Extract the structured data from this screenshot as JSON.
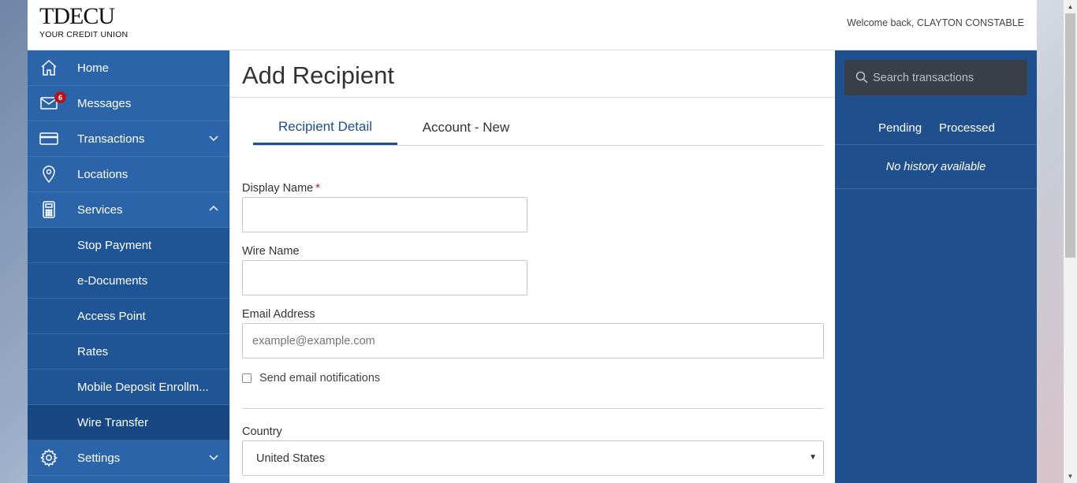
{
  "brand": {
    "logo_mark": "TDECU",
    "logo_tagline": "YOUR CREDIT UNION"
  },
  "header": {
    "welcome": "Welcome back, CLAYTON CONSTABLE"
  },
  "sidebar": {
    "items": [
      {
        "label": "Home",
        "icon": "home-icon"
      },
      {
        "label": "Messages",
        "icon": "envelope-icon",
        "badge": "6"
      },
      {
        "label": "Transactions",
        "icon": "card-icon"
      },
      {
        "label": "Locations",
        "icon": "map-pin-icon"
      },
      {
        "label": "Services",
        "icon": "calculator-icon"
      },
      {
        "label": "Stop Payment"
      },
      {
        "label": "e-Documents"
      },
      {
        "label": "Access Point"
      },
      {
        "label": "Rates"
      },
      {
        "label": "Mobile Deposit Enrollm..."
      },
      {
        "label": "Wire Transfer",
        "active": true
      },
      {
        "label": "Settings",
        "icon": "gear-icon"
      }
    ]
  },
  "main": {
    "title": "Add Recipient",
    "tabs": [
      {
        "label": "Recipient Detail",
        "active": true
      },
      {
        "label": "Account - New"
      }
    ],
    "form": {
      "display_name_label": "Display Name",
      "required_mark": "*",
      "display_name_value": "",
      "wire_name_label": "Wire Name",
      "wire_name_value": "",
      "email_label": "Email Address",
      "email_placeholder": "example@example.com",
      "send_email_label": "Send email notifications",
      "send_email_checked": false,
      "country_label": "Country",
      "country_value": "United States"
    }
  },
  "right_panel": {
    "search_placeholder": "Search transactions",
    "tabs": [
      {
        "label": "Pending"
      },
      {
        "label": "Processed"
      }
    ],
    "empty_message": "No history available"
  },
  "colors": {
    "sidebar_bg": "#2b64a8",
    "sub_bg": "#1f5597",
    "active_bg": "#174884",
    "right_bg": "#1f4f8c",
    "accent": "#1f4f8c",
    "badge": "#b8141f"
  }
}
